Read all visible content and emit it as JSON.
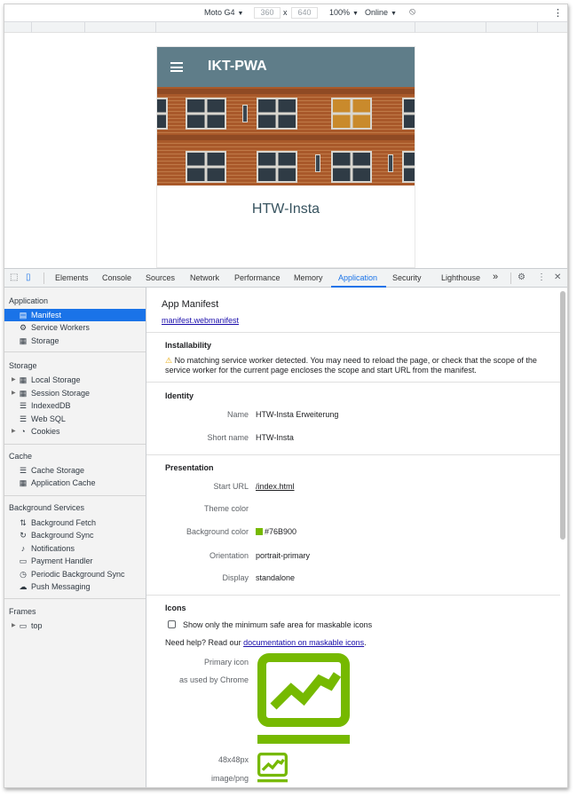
{
  "device_toolbar": {
    "device": "Moto G4",
    "width": "360",
    "times": "x",
    "height": "640",
    "zoom": "100%",
    "network": "Online",
    "more": "⋮"
  },
  "app": {
    "title": "IKT-PWA",
    "page_heading": "HTW-Insta"
  },
  "devtools": {
    "tabs": [
      "Elements",
      "Console",
      "Sources",
      "Network",
      "Performance",
      "Memory",
      "Application",
      "Security",
      "Lighthouse"
    ],
    "more_tabs": "»",
    "active_tab": "Application"
  },
  "sidebar": {
    "sections": {
      "application": "Application",
      "storage": "Storage",
      "cache": "Cache",
      "background": "Background Services",
      "frames": "Frames"
    },
    "application_items": [
      "Manifest",
      "Service Workers",
      "Storage"
    ],
    "storage_items": [
      "Local Storage",
      "Session Storage",
      "IndexedDB",
      "Web SQL",
      "Cookies"
    ],
    "cache_items": [
      "Cache Storage",
      "Application Cache"
    ],
    "background_items": [
      "Background Fetch",
      "Background Sync",
      "Notifications",
      "Payment Handler",
      "Periodic Background Sync",
      "Push Messaging"
    ],
    "frames_items": [
      "top"
    ]
  },
  "manifest": {
    "title": "App Manifest",
    "link": "manifest.webmanifest",
    "installability": {
      "heading": "Installability",
      "message": "No matching service worker detected. You may need to reload the page, or check that the scope of the service worker for the current page encloses the scope and start URL from the manifest."
    },
    "identity": {
      "heading": "Identity",
      "name_label": "Name",
      "name": "HTW-Insta Erweiterung",
      "short_name_label": "Short name",
      "short_name": "HTW-Insta"
    },
    "presentation": {
      "heading": "Presentation",
      "start_url_label": "Start URL",
      "start_url": "/index.html",
      "theme_color_label": "Theme color",
      "theme_color": "",
      "background_color_label": "Background color",
      "background_color": "#76B900",
      "orientation_label": "Orientation",
      "orientation": "portrait-primary",
      "display_label": "Display",
      "display": "standalone"
    },
    "icons": {
      "heading": "Icons",
      "checkbox_label": "Show only the minimum safe area for maskable icons",
      "help_prefix": "Need help? Read our ",
      "help_link": "documentation on maskable icons",
      "help_suffix": ".",
      "primary_label": "Primary icon",
      "primary_sub": "as used by Chrome",
      "small_size": "48x48px",
      "small_type": "image/png"
    }
  },
  "colors": {
    "accent": "#1a73e8",
    "app_bar": "#5f7d89",
    "icon_green": "#76B900"
  }
}
